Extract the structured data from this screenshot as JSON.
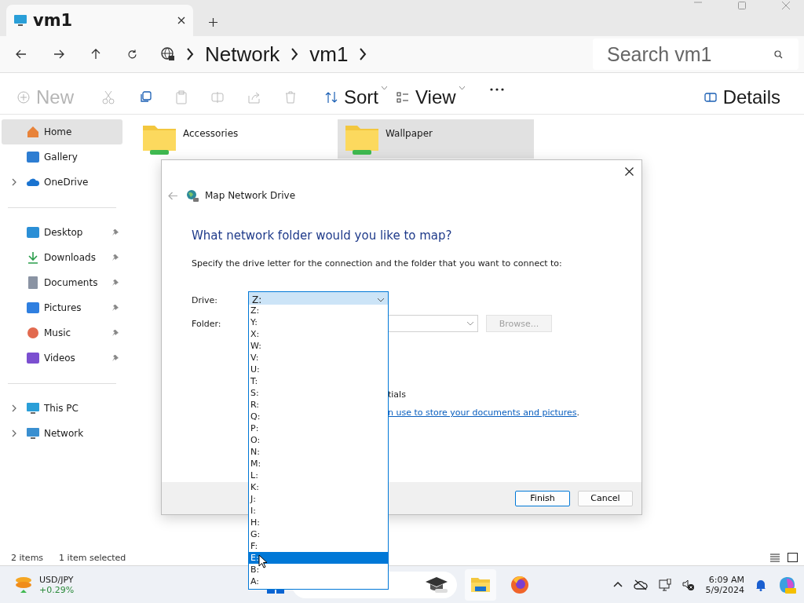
{
  "tab": {
    "title": "vm1",
    "selected": true
  },
  "address": {
    "segments": [
      "Network",
      "vm1"
    ]
  },
  "search": {
    "placeholder": "Search vm1"
  },
  "command_bar": {
    "new": {
      "label": "New",
      "disabled": true
    },
    "sort": "Sort",
    "view": "View",
    "details": "Details"
  },
  "sidebar": {
    "sections": [
      {
        "items": [
          {
            "label": "Home",
            "selected": true,
            "expandable": false,
            "pinned": false
          },
          {
            "label": "Gallery",
            "selected": false,
            "expandable": false,
            "pinned": false
          },
          {
            "label": "OneDrive",
            "selected": false,
            "expandable": true,
            "pinned": false
          }
        ]
      },
      {
        "items": [
          {
            "label": "Desktop",
            "selected": false,
            "expandable": false,
            "pinned": true
          },
          {
            "label": "Downloads",
            "selected": false,
            "expandable": false,
            "pinned": true
          },
          {
            "label": "Documents",
            "selected": false,
            "expandable": false,
            "pinned": true
          },
          {
            "label": "Pictures",
            "selected": false,
            "expandable": false,
            "pinned": true
          },
          {
            "label": "Music",
            "selected": false,
            "expandable": false,
            "pinned": true
          },
          {
            "label": "Videos",
            "selected": false,
            "expandable": false,
            "pinned": true
          }
        ]
      },
      {
        "items": [
          {
            "label": "This PC",
            "selected": false,
            "expandable": true,
            "pinned": false
          },
          {
            "label": "Network",
            "selected": false,
            "expandable": true,
            "pinned": false
          }
        ]
      }
    ]
  },
  "folders": [
    {
      "name": "Accessories",
      "selected": false
    },
    {
      "name": "Wallpaper",
      "selected": true
    }
  ],
  "status_bar": {
    "count": "2 items",
    "selection": "1 item selected"
  },
  "dialog": {
    "title": "Map Network Drive",
    "heading": "What network folder would you like to map?",
    "instruction": "Specify the drive letter for the connection and the folder that you want to connect to:",
    "drive_label": "Drive:",
    "drive_value": "Z:",
    "folder_label": "Folder:",
    "browse": {
      "label": "Browse...",
      "disabled": true
    },
    "checkbox_tail": "tials",
    "link_tail": "n use to store your documents and pictures",
    "link_after": ".",
    "buttons": [
      {
        "label": "Finish",
        "default": true
      },
      {
        "label": "Cancel",
        "default": false
      }
    ]
  },
  "drive_list": [
    {
      "label": "Z:",
      "selected": false
    },
    {
      "label": "Y:",
      "selected": false
    },
    {
      "label": "X:",
      "selected": false
    },
    {
      "label": "W:",
      "selected": false
    },
    {
      "label": "V:",
      "selected": false
    },
    {
      "label": "U:",
      "selected": false
    },
    {
      "label": "T:",
      "selected": false
    },
    {
      "label": "S:",
      "selected": false
    },
    {
      "label": "R:",
      "selected": false
    },
    {
      "label": "Q:",
      "selected": false
    },
    {
      "label": "P:",
      "selected": false
    },
    {
      "label": "O:",
      "selected": false
    },
    {
      "label": "N:",
      "selected": false
    },
    {
      "label": "M:",
      "selected": false
    },
    {
      "label": "L:",
      "selected": false
    },
    {
      "label": "K:",
      "selected": false
    },
    {
      "label": "J:",
      "selected": false
    },
    {
      "label": "I:",
      "selected": false
    },
    {
      "label": "H:",
      "selected": false
    },
    {
      "label": "G:",
      "selected": false
    },
    {
      "label": "F:",
      "selected": false
    },
    {
      "label": "E:",
      "selected": true
    },
    {
      "label": "B:",
      "selected": false
    },
    {
      "label": "A:",
      "selected": false
    }
  ],
  "taskbar": {
    "widget": {
      "title": "USD/JPY",
      "change": "+0.29%"
    },
    "clock": {
      "time": "6:09 AM",
      "date": "5/9/2024"
    }
  }
}
